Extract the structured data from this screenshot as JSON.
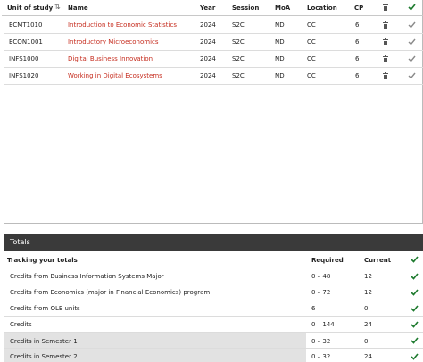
{
  "units_table": {
    "headers": {
      "unit": "Unit of study",
      "name": "Name",
      "year": "Year",
      "session": "Session",
      "moa": "MoA",
      "location": "Location",
      "cp": "CP"
    },
    "rows": [
      {
        "code": "ECMT1010",
        "name": "Introduction to Economic Statistics",
        "year": "2024",
        "session": "S2C",
        "moa": "ND",
        "location": "CC",
        "cp": "6"
      },
      {
        "code": "ECON1001",
        "name": "Introductory Microeconomics",
        "year": "2024",
        "session": "S2C",
        "moa": "ND",
        "location": "CC",
        "cp": "6"
      },
      {
        "code": "INFS1000",
        "name": "Digital Business Innovation",
        "year": "2024",
        "session": "S2C",
        "moa": "ND",
        "location": "CC",
        "cp": "6"
      },
      {
        "code": "INFS1020",
        "name": "Working in Digital Ecosystems",
        "year": "2024",
        "session": "S2C",
        "moa": "ND",
        "location": "CC",
        "cp": "6"
      }
    ]
  },
  "totals": {
    "title": "Totals",
    "headers": {
      "tracking": "Tracking your totals",
      "required": "Required",
      "current": "Current"
    },
    "rows": [
      {
        "label": "Credits from Business Information Systems Major",
        "required": "0 – 48",
        "current": "12"
      },
      {
        "label": "Credits from Economics (major in Financial Economics) program",
        "required": "0 – 72",
        "current": "12"
      },
      {
        "label": "Credits from OLE units",
        "required": "6",
        "current": "0"
      },
      {
        "label": "Credits",
        "required": "0 – 144",
        "current": "24"
      },
      {
        "label": "Credits in Semester 1",
        "required": "0 – 32",
        "current": "0"
      },
      {
        "label": "Credits in Semester 2",
        "required": "0 – 32",
        "current": "24"
      }
    ]
  },
  "colors": {
    "accent_link": "#c62d1f",
    "check_green": "#1d7a2e",
    "totals_bar": "#3a3a3a"
  }
}
